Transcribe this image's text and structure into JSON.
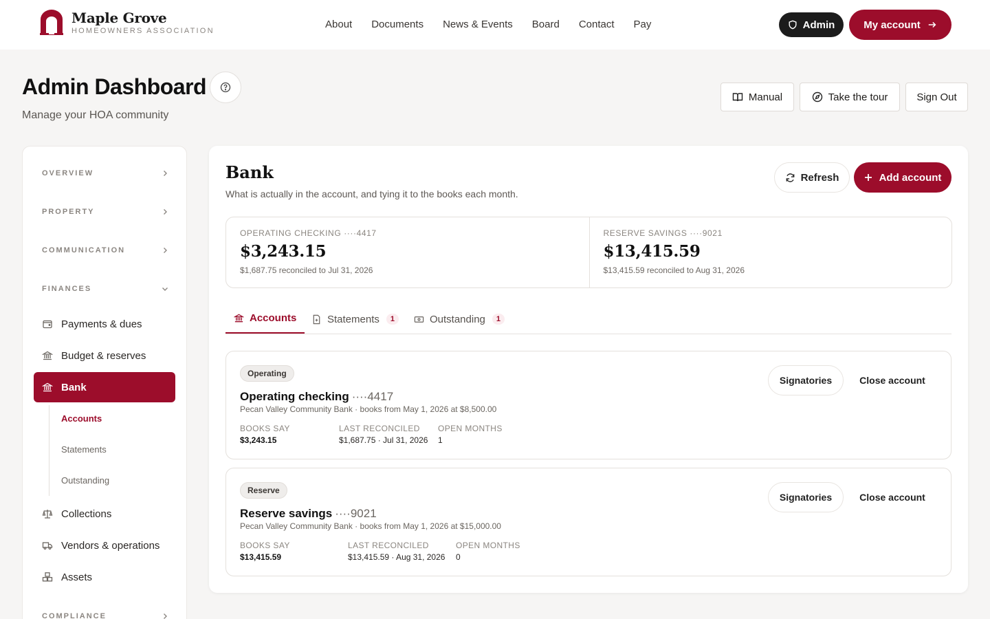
{
  "brand": {
    "name": "Maple Grove",
    "subtitle": "HOMEOWNERS ASSOCIATION",
    "accent_color": "#9c0d2b"
  },
  "nav": {
    "links": [
      "About",
      "Documents",
      "News & Events",
      "Board",
      "Contact",
      "Pay"
    ],
    "admin_label": "Admin",
    "my_account_label": "My account"
  },
  "header": {
    "title": "Admin Dashboard",
    "subtitle": "Manage your HOA community",
    "manual_label": "Manual",
    "tour_label": "Take the tour",
    "signout_label": "Sign Out"
  },
  "sidebar": {
    "sections": {
      "overview": "OVERVIEW",
      "property": "PROPERTY",
      "communication": "COMMUNICATION",
      "finances": "FINANCES",
      "compliance": "COMPLIANCE"
    },
    "finance_items": {
      "payments": "Payments & dues",
      "budget": "Budget & reserves",
      "bank": "Bank",
      "collections": "Collections",
      "vendors": "Vendors & operations",
      "assets": "Assets"
    },
    "bank_sub": {
      "accounts": "Accounts",
      "statements": "Statements",
      "outstanding": "Outstanding"
    }
  },
  "main": {
    "title": "Bank",
    "subtitle": "What is actually in the account, and tying it to the books each month.",
    "refresh_label": "Refresh",
    "add_label": "Add account",
    "summary": [
      {
        "label": "OPERATING CHECKING ····4417",
        "amount": "$3,243.15",
        "note": "$1,687.75 reconciled to Jul 31, 2026"
      },
      {
        "label": "RESERVE SAVINGS ····9021",
        "amount": "$13,415.59",
        "note": "$13,415.59 reconciled to Aug 31, 2026"
      }
    ],
    "tabs": {
      "accounts": "Accounts",
      "statements": "Statements",
      "statements_count": "1",
      "outstanding": "Outstanding",
      "outstanding_count": "1"
    },
    "accounts": [
      {
        "tag": "Operating",
        "name": "Operating checking",
        "mask": "····4417",
        "bank": "Pecan Valley Community Bank · books from May 1, 2026 at $8,500.00",
        "books_label": "BOOKS SAY",
        "books_value": "$3,243.15",
        "reconciled_label": "LAST RECONCILED",
        "reconciled_value": "$1,687.75 · Jul 31, 2026",
        "open_label": "OPEN MONTHS",
        "open_value": "1",
        "sig_label": "Signatories",
        "close_label": "Close account"
      },
      {
        "tag": "Reserve",
        "name": "Reserve savings",
        "mask": "····9021",
        "bank": "Pecan Valley Community Bank · books from May 1, 2026 at $15,000.00",
        "books_label": "BOOKS SAY",
        "books_value": "$13,415.59",
        "reconciled_label": "LAST RECONCILED",
        "reconciled_value": "$13,415.59 · Aug 31, 2026",
        "open_label": "OPEN MONTHS",
        "open_value": "0",
        "sig_label": "Signatories",
        "close_label": "Close account"
      }
    ]
  }
}
